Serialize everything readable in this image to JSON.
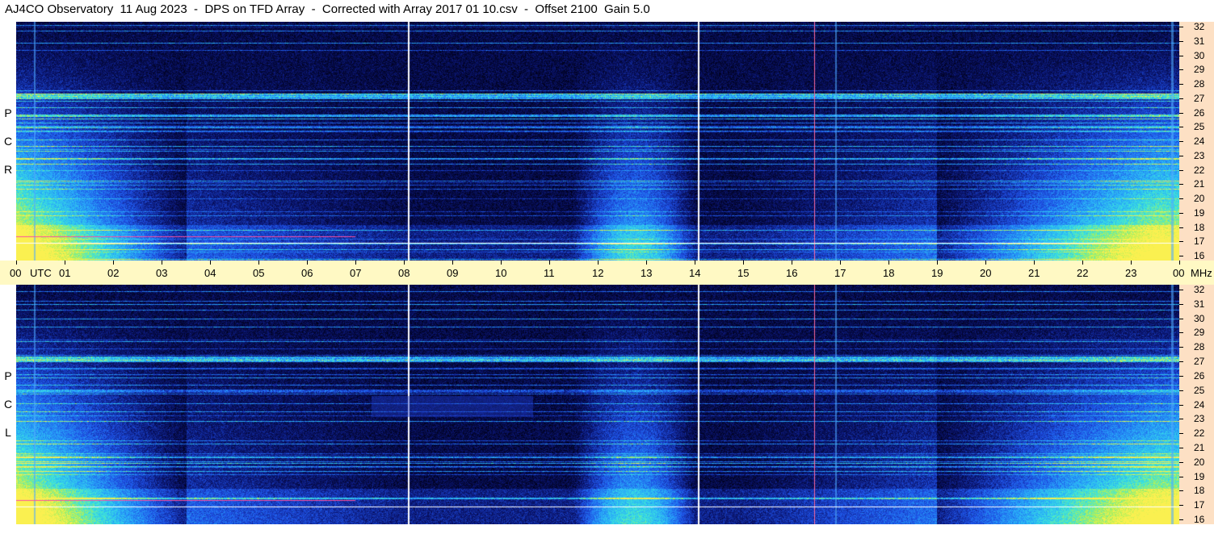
{
  "window": {
    "title": "AJ4CO Observatory  11 Aug 2023  -  DPS on TFD Array  -  Corrected with Array 2017 01 10.csv  -  Offset 2100  Gain 5.0"
  },
  "panels": {
    "top": {
      "polarization_letters": [
        "R",
        "C",
        "P"
      ]
    },
    "bottom": {
      "polarization_letters": [
        "L",
        "C",
        "P"
      ]
    }
  },
  "frequency_axis": {
    "unit": "MHz",
    "labels": [
      "32",
      "31",
      "30",
      "29",
      "28",
      "27",
      "26",
      "25",
      "24",
      "23",
      "22",
      "21",
      "20",
      "19",
      "18",
      "17",
      "16"
    ]
  },
  "time_axis": {
    "labels": [
      "00",
      "01",
      "02",
      "03",
      "04",
      "05",
      "06",
      "07",
      "08",
      "09",
      "10",
      "11",
      "12",
      "13",
      "14",
      "15",
      "16",
      "17",
      "18",
      "19",
      "20",
      "21",
      "22",
      "23",
      "00"
    ],
    "timezone": "UTC",
    "end_unit": "MHz"
  },
  "colors": {
    "background": "#000018",
    "low": "#0a1a8c",
    "mid": "#2f7dff",
    "high": "#3de8e0",
    "peak": "#c8f04a",
    "hot": "#ff4fa0",
    "mhz_strip": "#fde0c4",
    "utc_bar": "#fff9c4"
  }
}
